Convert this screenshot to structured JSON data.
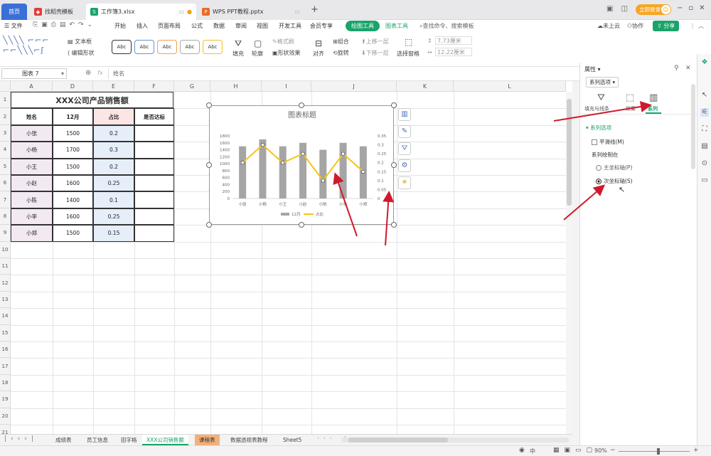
{
  "tabs": {
    "home": "首页",
    "t1": "找稻壳模板",
    "t2": "工作簿3.xlsx",
    "t3": "WPS PPT教程.pptx",
    "add": "+",
    "login": "立即登录"
  },
  "menu": {
    "file": "文件",
    "items": [
      "开始",
      "插入",
      "页面布局",
      "公式",
      "数据",
      "审阅",
      "视图",
      "开发工具",
      "会员专享"
    ],
    "draw_tools": "绘图工具",
    "chart_tools": "图表工具",
    "search": "查找命令、搜索模板",
    "cloud": "未上云",
    "collab": "协作",
    "share": "分享"
  },
  "ribbon": {
    "textbox": "文本框",
    "edit_shape": "编辑形状",
    "style_label": "Abc",
    "fill": "填充",
    "outline": "轮廓",
    "format_painter": "格式刷",
    "shape_effect": "形状效果",
    "align": "对齐",
    "group": "组合",
    "rotate": "旋转",
    "up_layer": "上移一层",
    "down_layer": "下移一层",
    "select_pane": "选择窗格",
    "height": "7.73厘米",
    "width": "12.22厘米"
  },
  "formula_bar": {
    "namebox": "图表 7",
    "fx": "fx",
    "value": "姓名"
  },
  "columns": [
    "A",
    "D",
    "E",
    "F",
    "G",
    "H",
    "I",
    "J",
    "K",
    "L"
  ],
  "rows": [
    "1",
    "2",
    "3",
    "4",
    "5",
    "6",
    "7",
    "8",
    "9",
    "10",
    "11",
    "12",
    "13",
    "14",
    "15",
    "16",
    "17",
    "18",
    "19",
    "20",
    "21"
  ],
  "table": {
    "title": "XXX公司产品销售额",
    "headers": [
      "姓名",
      "12月",
      "占比",
      "是否达标"
    ],
    "data": [
      [
        "小张",
        "1500",
        "0.2",
        ""
      ],
      [
        "小杨",
        "1700",
        "0.3",
        ""
      ],
      [
        "小王",
        "1500",
        "0.2",
        ""
      ],
      [
        "小赵",
        "1600",
        "0.25",
        ""
      ],
      [
        "小陈",
        "1400",
        "0.1",
        ""
      ],
      [
        "小李",
        "1600",
        "0.25",
        ""
      ],
      [
        "小郑",
        "1500",
        "0.15",
        ""
      ]
    ]
  },
  "chart_data": {
    "type": "bar",
    "title": "图表标题",
    "categories": [
      "小张",
      "小杨",
      "小王",
      "小赵",
      "小陈",
      "小李",
      "小郑"
    ],
    "series": [
      {
        "name": "12月",
        "type": "bar",
        "axis": "primary",
        "values": [
          1500,
          1700,
          1500,
          1600,
          1400,
          1600,
          1500
        ],
        "color": "#a5a5a5"
      },
      {
        "name": "占比",
        "type": "line",
        "axis": "secondary",
        "values": [
          0.2,
          0.3,
          0.2,
          0.25,
          0.1,
          0.25,
          0.15
        ],
        "color": "#f5c518"
      }
    ],
    "y_ticks": [
      "0",
      "200",
      "400",
      "600",
      "800",
      "1000",
      "1200",
      "1400",
      "1600",
      "1800"
    ],
    "y2_ticks": [
      "0",
      "0.05",
      "0.1",
      "0.15",
      "0.2",
      "0.25",
      "0.3",
      "0.35"
    ],
    "ylim": [
      0,
      1800
    ],
    "y2lim": [
      0,
      0.35
    ],
    "legend_position": "bottom",
    "grid": false
  },
  "sheet_tabs": [
    "成绩表",
    "员工信息",
    "田字格",
    "XXX公司销售额",
    "课程表",
    "数据透视表教程",
    "Sheet5"
  ],
  "active_sheet": "XXX公司销售额",
  "status": {
    "zoom": "90%",
    "ime": "中"
  },
  "panel": {
    "title": "属性",
    "dropdown": "系列选项",
    "tab_fill": "填充与线条",
    "tab_effect": "效果",
    "tab_series": "系列",
    "section": "系列选项",
    "smooth": "平滑线(M)",
    "plot_on": "系列绘制在",
    "primary": "主坐标轴(P)",
    "secondary": "次坐标轴(S)"
  },
  "colors": {
    "accent": "#1aa36b",
    "arrow": "#d0192b",
    "bar": "#a5a5a5",
    "line": "#f5c518"
  }
}
